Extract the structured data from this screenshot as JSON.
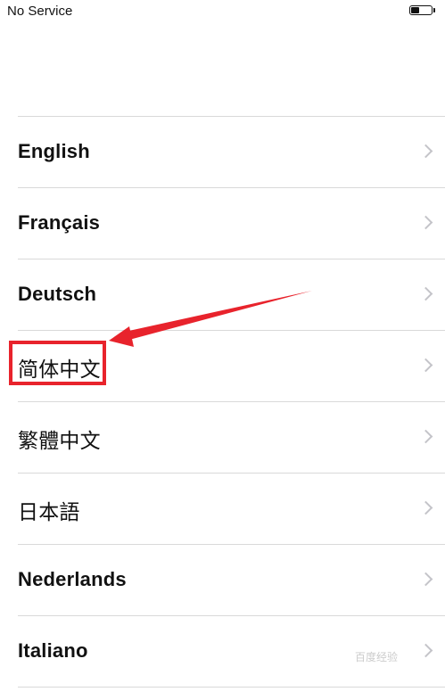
{
  "status_bar": {
    "carrier": "No Service",
    "battery_icon": "battery-icon",
    "battery_level": 0.45
  },
  "languages": [
    {
      "label": "English",
      "icon": "chevron-right-icon"
    },
    {
      "label": "Français",
      "icon": "chevron-right-icon"
    },
    {
      "label": "Deutsch",
      "icon": "chevron-right-icon"
    },
    {
      "label": "简体中文",
      "icon": "chevron-right-icon",
      "highlighted": true
    },
    {
      "label": "繁體中文",
      "icon": "chevron-right-icon"
    },
    {
      "label": "日本語",
      "icon": "chevron-right-icon"
    },
    {
      "label": "Nederlands",
      "icon": "chevron-right-icon"
    },
    {
      "label": "Italiano",
      "icon": "chevron-right-icon"
    }
  ],
  "colors": {
    "annotation": "#e8232c",
    "separator": "#d9d9d9",
    "chevron": "#c4c4c9"
  },
  "watermark": "百度经验"
}
